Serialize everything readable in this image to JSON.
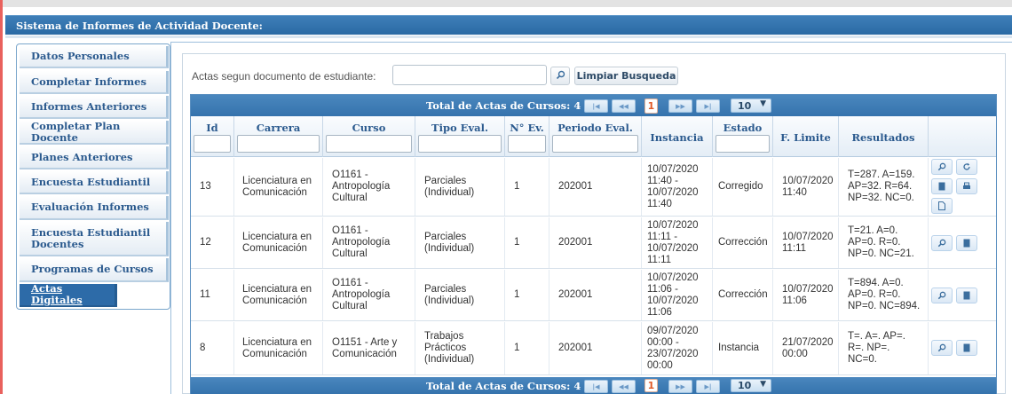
{
  "app_title": "Sistema de Informes de Actividad Docente:",
  "sidebar": {
    "items": [
      {
        "label": "Datos Personales"
      },
      {
        "label": "Completar Informes"
      },
      {
        "label": "Informes Anteriores"
      },
      {
        "label": "Completar Plan Docente"
      },
      {
        "label": "Planes Anteriores"
      },
      {
        "label": "Encuesta Estudiantil"
      },
      {
        "label": "Evaluación Informes"
      },
      {
        "label": "Encuesta Estudiantil Docentes"
      },
      {
        "label": "Programas de Cursos"
      },
      {
        "label": "Actas Digitales",
        "active": true
      }
    ]
  },
  "search": {
    "label": "Actas segun documento de estudiante:",
    "value": "",
    "clear_label": "Limpiar Busqueda"
  },
  "table": {
    "title": "Total de Actas de Cursos: 4",
    "current_page": "1",
    "page_size": "10",
    "columns": [
      "Id",
      "Carrera",
      "Curso",
      "Tipo Eval.",
      "N° Ev.",
      "Periodo Eval.",
      "Instancia",
      "Estado",
      "F. Limite",
      "Resultados"
    ],
    "rows": [
      {
        "id": "13",
        "carrera": "Licenciatura en Comunicación",
        "curso": "O1161 - Antropología Cultural",
        "tipo": "Parciales (Individual)",
        "nev": "1",
        "periodo": "202001",
        "instancia": "10/07/2020 11:40 - 10/07/2020 11:40",
        "estado": "Corregido",
        "flimite": "10/07/2020 11:40",
        "resultados": "T=287. A=159. AP=32. R=64. NP=32. NC=0.",
        "actions": [
          "search-icon",
          "refresh-icon",
          "document-icon",
          "print-icon",
          "file-icon"
        ]
      },
      {
        "id": "12",
        "carrera": "Licenciatura en Comunicación",
        "curso": "O1161 - Antropología Cultural",
        "tipo": "Parciales (Individual)",
        "nev": "1",
        "periodo": "202001",
        "instancia": "10/07/2020 11:11 - 10/07/2020 11:11",
        "estado": "Corrección",
        "flimite": "10/07/2020 11:11",
        "resultados": "T=21. A=0. AP=0. R=0. NP=0. NC=21.",
        "actions": [
          "search-icon",
          "document-icon"
        ]
      },
      {
        "id": "11",
        "carrera": "Licenciatura en Comunicación",
        "curso": "O1161 - Antropología Cultural",
        "tipo": "Parciales (Individual)",
        "nev": "1",
        "periodo": "202001",
        "instancia": "10/07/2020 11:06 - 10/07/2020 11:06",
        "estado": "Corrección",
        "flimite": "10/07/2020 11:06",
        "resultados": "T=894. A=0. AP=0. R=0. NP=0. NC=894.",
        "actions": [
          "search-icon",
          "document-icon"
        ]
      },
      {
        "id": "8",
        "carrera": "Licenciatura en Comunicación",
        "curso": "O1151 - Arte y Comunicación",
        "tipo": "Trabajos Prácticos (Individual)",
        "nev": "1",
        "periodo": "202001",
        "instancia": "09/07/2020 00:00 - 23/07/2020 00:00",
        "estado": "Instancia",
        "flimite": "21/07/2020 00:00",
        "resultados": "T=. A=. AP=. R=. NP=. NC=0.",
        "actions": [
          "search-icon",
          "document-icon"
        ]
      }
    ]
  }
}
